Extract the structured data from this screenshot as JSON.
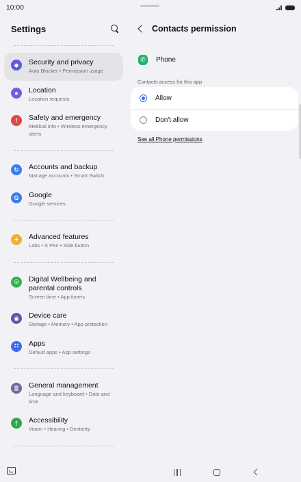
{
  "status_bar": {
    "time": "10:00"
  },
  "settings": {
    "title": "Settings",
    "groups": [
      [
        {
          "title": "Security and privacy",
          "subtitle": "Auto Blocker  •  Permission usage",
          "icon": "shield-icon",
          "color": "#5b5bd6",
          "selected": true
        },
        {
          "title": "Location",
          "subtitle": "Location requests",
          "icon": "location-pin-icon",
          "color": "#7a5ae0"
        },
        {
          "title": "Safety and emergency",
          "subtitle": "Medical info  •  Wireless emergency alerts",
          "icon": "emergency-icon",
          "color": "#e04646"
        }
      ],
      [
        {
          "title": "Accounts and backup",
          "subtitle": "Manage accounts  •  Smart Switch",
          "icon": "sync-icon",
          "color": "#3c7cf0"
        },
        {
          "title": "Google",
          "subtitle": "Google services",
          "icon": "google-icon",
          "color": "#3c7cf0"
        }
      ],
      [
        {
          "title": "Advanced features",
          "subtitle": "Labs  •  S Pen  •  Side button",
          "icon": "gear-plus-icon",
          "color": "#f0b030"
        }
      ],
      [
        {
          "title": "Digital Wellbeing and parental controls",
          "subtitle": "Screen time  •  App timers",
          "icon": "wellbeing-icon",
          "color": "#2fb24a"
        },
        {
          "title": "Device care",
          "subtitle": "Storage  •  Memory  •  App protection",
          "icon": "device-care-icon",
          "color": "#5a5aa6"
        },
        {
          "title": "Apps",
          "subtitle": "Default apps  •  App settings",
          "icon": "apps-grid-icon",
          "color": "#3c6ee8"
        }
      ],
      [
        {
          "title": "General management",
          "subtitle": "Language and keyboard  •  Date and time",
          "icon": "sliders-icon",
          "color": "#6a6a9a"
        },
        {
          "title": "Accessibility",
          "subtitle": "Vision  •  Hearing  •  Dexterity",
          "icon": "accessibility-icon",
          "color": "#2fa84a"
        }
      ]
    ]
  },
  "permission": {
    "title": "Contacts permission",
    "app_name": "Phone",
    "section_label": "Contacts access for this app",
    "options": [
      {
        "label": "Allow",
        "checked": true
      },
      {
        "label": "Don't allow",
        "checked": false
      }
    ],
    "see_all_label": "See all Phone permissions"
  }
}
